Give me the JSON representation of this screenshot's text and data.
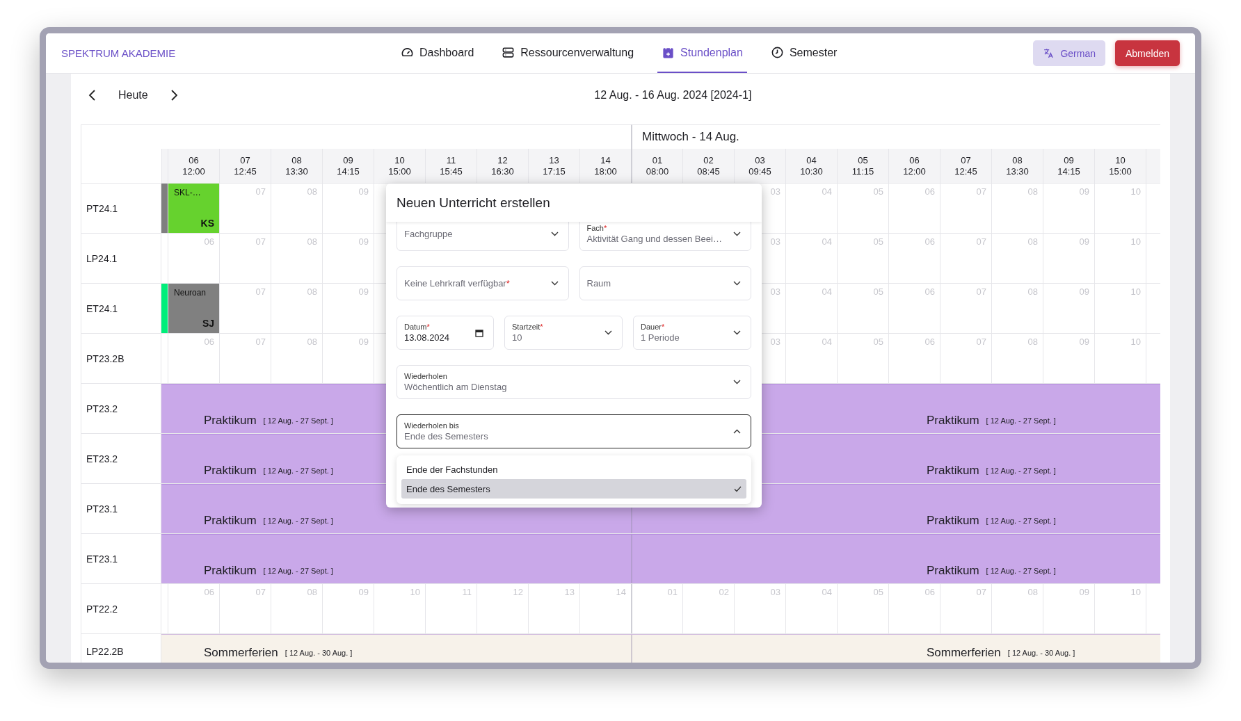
{
  "brand": "SPEKTRUM AKADEMIE",
  "nav": [
    {
      "label": "Dashboard",
      "selected": false
    },
    {
      "label": "Ressourcenverwaltung",
      "selected": false
    },
    {
      "label": "Stundenplan",
      "selected": true
    },
    {
      "label": "Semester",
      "selected": false
    }
  ],
  "language_button": "German",
  "logout_button": "Abmelden",
  "toolbar": {
    "today": "Heute",
    "range": "12 Aug. - 16 Aug. 2024 [2024-1]"
  },
  "days": [
    {
      "slots": [
        {
          "number": "06",
          "time": "12:00"
        },
        {
          "number": "07",
          "time": "12:45"
        },
        {
          "number": "08",
          "time": "13:30"
        },
        {
          "number": "09",
          "time": "14:15"
        },
        {
          "number": "10",
          "time": "15:00"
        },
        {
          "number": "11",
          "time": "15:45"
        },
        {
          "number": "12",
          "time": "16:30"
        },
        {
          "number": "13",
          "time": "17:15"
        },
        {
          "number": "14",
          "time": "18:00"
        }
      ]
    },
    {
      "title": "Mittwoch - 14 Aug.",
      "slots": [
        {
          "number": "01",
          "time": "08:00"
        },
        {
          "number": "02",
          "time": "08:45"
        },
        {
          "number": "03",
          "time": "09:45"
        },
        {
          "number": "04",
          "time": "10:30"
        },
        {
          "number": "05",
          "time": "11:15"
        },
        {
          "number": "06",
          "time": "12:00"
        },
        {
          "number": "07",
          "time": "12:45"
        },
        {
          "number": "08",
          "time": "13:30"
        },
        {
          "number": "09",
          "time": "14:15"
        },
        {
          "number": "10",
          "time": "15:00"
        }
      ]
    }
  ],
  "rows": [
    {
      "label": "PT24.1",
      "kind": "slots",
      "strip": {
        "color": "#7f7f7f"
      },
      "day1": [
        {
          "kind": "lesson",
          "title": "SKL-…",
          "teacher": "KS",
          "color": "#66d22e"
        },
        {
          "kind": "slot",
          "number": "07"
        },
        {
          "kind": "slot",
          "number": "08"
        },
        {
          "kind": "slot",
          "number": "09"
        }
      ],
      "day2_end": [
        {
          "kind": "slot",
          "number": "03"
        },
        {
          "kind": "slot",
          "number": "04"
        },
        {
          "kind": "slot",
          "number": "05"
        },
        {
          "kind": "slot",
          "number": "06"
        },
        {
          "kind": "slot",
          "number": "07"
        },
        {
          "kind": "slot",
          "number": "08"
        },
        {
          "kind": "slot",
          "number": "09"
        },
        {
          "kind": "slot",
          "number": "10"
        }
      ]
    },
    {
      "label": "LP24.1",
      "kind": "slots",
      "day1": [
        {
          "kind": "slot",
          "number": "06"
        },
        {
          "kind": "slot",
          "number": "07"
        },
        {
          "kind": "slot",
          "number": "08"
        },
        {
          "kind": "slot",
          "number": "09"
        }
      ],
      "day2_end": [
        {
          "kind": "slot",
          "number": "03"
        },
        {
          "kind": "slot",
          "number": "04"
        },
        {
          "kind": "slot",
          "number": "05"
        },
        {
          "kind": "slot",
          "number": "06"
        },
        {
          "kind": "slot",
          "number": "07"
        },
        {
          "kind": "slot",
          "number": "08"
        },
        {
          "kind": "slot",
          "number": "09"
        },
        {
          "kind": "slot",
          "number": "10"
        }
      ]
    },
    {
      "label": "ET24.1",
      "kind": "slots",
      "strip": {
        "color": "#00ee7a"
      },
      "day1": [
        {
          "kind": "lesson",
          "title": "Neuroan",
          "teacher": "SJ",
          "color": "#808080"
        },
        {
          "kind": "slot",
          "number": "07"
        },
        {
          "kind": "slot",
          "number": "08"
        },
        {
          "kind": "slot",
          "number": "09"
        }
      ],
      "day2_end": [
        {
          "kind": "slot",
          "number": "03"
        },
        {
          "kind": "slot",
          "number": "04"
        },
        {
          "kind": "slot",
          "number": "05"
        },
        {
          "kind": "slot",
          "number": "06"
        },
        {
          "kind": "slot",
          "number": "07"
        },
        {
          "kind": "slot",
          "number": "08"
        },
        {
          "kind": "slot",
          "number": "09"
        },
        {
          "kind": "slot",
          "number": "10"
        }
      ]
    },
    {
      "label": "PT23.2B",
      "kind": "slots",
      "day1": [
        {
          "kind": "slot",
          "number": "06"
        },
        {
          "kind": "slot",
          "number": "07"
        },
        {
          "kind": "slot",
          "number": "08"
        },
        {
          "kind": "slot",
          "number": "09"
        }
      ],
      "day2_end": [
        {
          "kind": "slot",
          "number": "03"
        },
        {
          "kind": "slot",
          "number": "04"
        },
        {
          "kind": "slot",
          "number": "05"
        },
        {
          "kind": "slot",
          "number": "06"
        },
        {
          "kind": "slot",
          "number": "07"
        },
        {
          "kind": "slot",
          "number": "08"
        },
        {
          "kind": "slot",
          "number": "09"
        },
        {
          "kind": "slot",
          "number": "10"
        }
      ]
    },
    {
      "label": "PT23.2",
      "kind": "band",
      "color": "#c9a8e9",
      "labels": [
        {
          "title": "Praktikum",
          "range": "[ 12 Aug. - 27 Sept. ]"
        },
        {
          "title": "Praktikum",
          "range": "[ 12 Aug. - 27 Sept. ]"
        }
      ]
    },
    {
      "label": "ET23.2",
      "kind": "band",
      "color": "#c9a8e9",
      "labels": [
        {
          "title": "Praktikum",
          "range": "[ 12 Aug. - 27 Sept. ]"
        },
        {
          "title": "Praktikum",
          "range": "[ 12 Aug. - 27 Sept. ]"
        }
      ]
    },
    {
      "label": "PT23.1",
      "kind": "band",
      "color": "#c9a8e9",
      "labels": [
        {
          "title": "Praktikum",
          "range": "[ 12 Aug. - 27 Sept. ]"
        },
        {
          "title": "Praktikum",
          "range": "[ 12 Aug. - 27 Sept. ]"
        }
      ]
    },
    {
      "label": "ET23.1",
      "kind": "band",
      "color": "#c9a8e9",
      "labels": [
        {
          "title": "Praktikum",
          "range": "[ 12 Aug. - 27 Sept. ]"
        },
        {
          "title": "Praktikum",
          "range": "[ 12 Aug. - 27 Sept. ]"
        }
      ]
    },
    {
      "label": "PT22.2",
      "kind": "slots",
      "day1": [
        {
          "kind": "slot",
          "number": "06"
        },
        {
          "kind": "slot",
          "number": "07"
        },
        {
          "kind": "slot",
          "number": "08"
        },
        {
          "kind": "slot",
          "number": "09"
        },
        {
          "kind": "slot",
          "number": "10"
        },
        {
          "kind": "slot",
          "number": "11"
        },
        {
          "kind": "slot",
          "number": "12"
        },
        {
          "kind": "slot",
          "number": "13"
        },
        {
          "kind": "slot",
          "number": "14"
        }
      ],
      "day2_end": [
        {
          "kind": "slot",
          "number": "01"
        },
        {
          "kind": "slot",
          "number": "02"
        },
        {
          "kind": "slot",
          "number": "03"
        },
        {
          "kind": "slot",
          "number": "04"
        },
        {
          "kind": "slot",
          "number": "05"
        },
        {
          "kind": "slot",
          "number": "06"
        },
        {
          "kind": "slot",
          "number": "07"
        },
        {
          "kind": "slot",
          "number": "08"
        },
        {
          "kind": "slot",
          "number": "09"
        },
        {
          "kind": "slot",
          "number": "10"
        }
      ]
    },
    {
      "label": "LP22.2B",
      "kind": "band",
      "color": "#f7f2ea",
      "labels": [
        {
          "title": "Sommerferien",
          "range": "[ 12 Aug. - 30 Aug. ]"
        },
        {
          "title": "Sommerferien",
          "range": "[ 12 Aug. - 30 Aug. ]"
        }
      ]
    }
  ],
  "dialog": {
    "title": "Neuen Unterricht erstellen",
    "field_rows": [
      [
        {
          "kind": "select",
          "label": "Fachgruppe"
        },
        {
          "kind": "select",
          "label": "Fach",
          "mark": "*",
          "value": "Aktivität Gang und dessen Beei…"
        }
      ],
      [
        {
          "kind": "select",
          "label": "Keine Lehrkraft verfügbar",
          "mark": "*"
        },
        {
          "kind": "select",
          "label": "Raum"
        }
      ],
      [
        {
          "kind": "date",
          "label": "Datum",
          "mark": "*",
          "value": "13.08.2024"
        },
        {
          "kind": "select",
          "label": "Startzeit",
          "mark": "*",
          "value": "10"
        },
        {
          "kind": "select",
          "label": "Dauer",
          "mark": "*",
          "value": "1 Periode"
        }
      ],
      [
        {
          "kind": "select",
          "label": "Wiederholen",
          "value": "Wöchentlich am Dienstag"
        }
      ],
      [
        {
          "kind": "select",
          "label": "Wiederholen bis",
          "value": "Ende des Semesters",
          "expanded": true
        }
      ]
    ],
    "options": [
      {
        "label": "Ende der Fachstunden",
        "selected": false
      },
      {
        "label": "Ende des Semesters",
        "selected": true
      }
    ]
  }
}
